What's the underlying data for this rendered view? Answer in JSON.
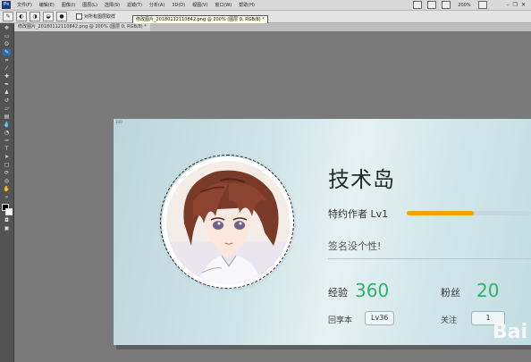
{
  "menubar": {
    "logo": "Ps",
    "items": [
      "文件(F)",
      "编辑(E)",
      "图像(I)",
      "图层(L)",
      "选择(S)",
      "滤镜(T)",
      "分析(A)",
      "3D(D)",
      "视图(V)",
      "窗口(W)",
      "帮助(H)"
    ],
    "zoom": "200%"
  },
  "options": {
    "checkbox_label": "对所有图层取样",
    "tooltip": "修改图片_20180112110842.png @ 200% (图层 0, RGB/8) *"
  },
  "document": {
    "tab_title": "修改图片_20180112110842.png @ 200% (图层 0, RGB/8) *"
  },
  "canvas": {
    "label": "100",
    "name": "技术岛",
    "level_label": "特约作者 Lv1",
    "level_progress": 0.54,
    "signature": "签名没个性!",
    "stats": {
      "exp_label": "经验",
      "exp_value": "360",
      "fans_label": "粉丝",
      "fans_value": "20",
      "reward_label": "回享本",
      "reward_badge": "Lv36",
      "follow_label": "关注",
      "follow_badge": "1"
    },
    "watermark": "Bai"
  },
  "colors": {
    "accent": "#f3a300",
    "stat_green": "#2fb36a"
  }
}
